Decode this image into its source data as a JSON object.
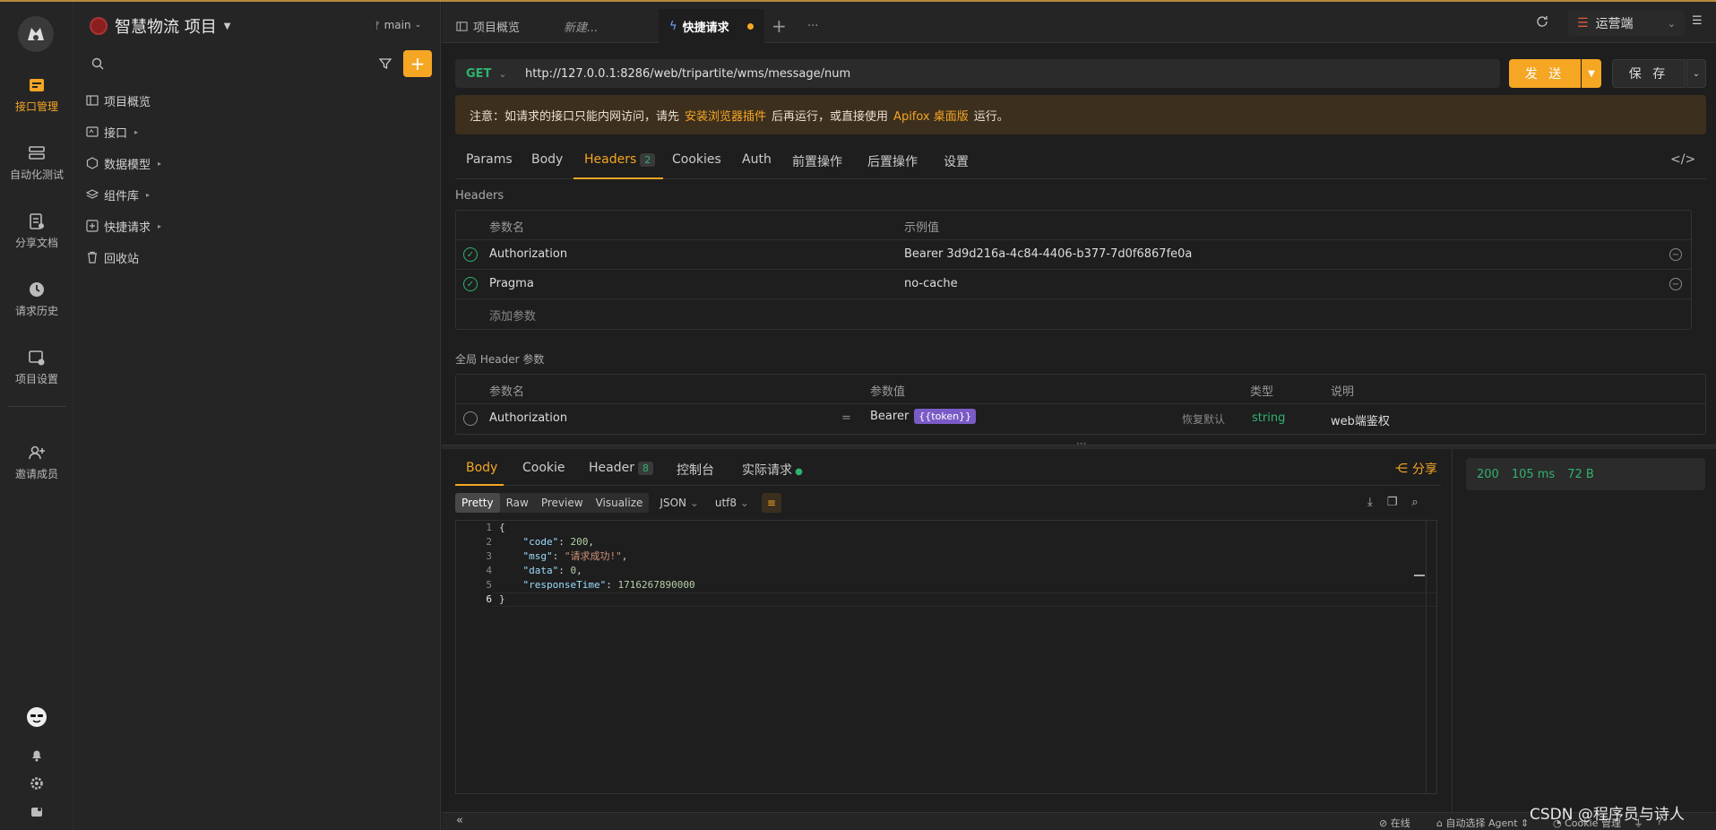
{
  "rail": {
    "items": [
      {
        "label": "接口管理",
        "icon": "api-icon",
        "active": true
      },
      {
        "label": "自动化测试",
        "icon": "automation-icon"
      },
      {
        "label": "分享文档",
        "icon": "doc-share-icon"
      },
      {
        "label": "请求历史",
        "icon": "history-icon"
      },
      {
        "label": "项目设置",
        "icon": "project-settings-icon"
      },
      {
        "label": "邀请成员",
        "icon": "invite-member-icon"
      }
    ]
  },
  "project": {
    "name": "智慧物流 项目",
    "branch": "main"
  },
  "tree": {
    "items": [
      {
        "label": "项目概览",
        "icon": "overview-icon",
        "caret": false
      },
      {
        "label": "接口",
        "icon": "api-folder-icon",
        "caret": true
      },
      {
        "label": "数据模型",
        "icon": "data-model-icon",
        "caret": true
      },
      {
        "label": "组件库",
        "icon": "components-icon",
        "caret": true
      },
      {
        "label": "快捷请求",
        "icon": "quick-request-icon",
        "caret": true
      },
      {
        "label": "回收站",
        "icon": "trash-icon",
        "caret": false
      }
    ]
  },
  "tabs": [
    {
      "label": "项目概览",
      "active": false
    },
    {
      "label": "新建...",
      "active": false
    },
    {
      "label": "快捷请求",
      "active": true
    }
  ],
  "env": {
    "label": "运营端"
  },
  "request": {
    "method": "GET",
    "url": "http://127.0.0.1:8286/web/tripartite/wms/message/num",
    "send_label": "发 送",
    "save_label": "保 存"
  },
  "notice": {
    "prefix": "注意：如请求的接口只能内网访问，请先",
    "link1": "安装浏览器插件",
    "middle": "后再运行，或直接使用",
    "link2": "Apifox 桌面版",
    "suffix": "运行。"
  },
  "req_tabs": {
    "params": "Params",
    "body": "Body",
    "headers": "Headers",
    "headers_count": "2",
    "cookies": "Cookies",
    "auth": "Auth",
    "pre": "前置操作",
    "post": "后置操作",
    "settings": "设置"
  },
  "headers": {
    "section": "Headers",
    "col_name": "参数名",
    "col_example": "示例值",
    "rows": [
      {
        "name": "Authorization",
        "value": "Bearer 3d9d216a-4c84-4406-b377-7d0f6867fe0a"
      },
      {
        "name": "Pragma",
        "value": "no-cache"
      }
    ],
    "add_placeholder": "添加参数"
  },
  "global_headers": {
    "section": "全局 Header 参数",
    "col_name": "参数名",
    "col_value": "参数值",
    "col_type": "类型",
    "col_desc": "说明",
    "row": {
      "name": "Authorization",
      "eq": "=",
      "value": "Bearer",
      "token": "{{token}}",
      "restore": "恢复默认",
      "type": "string",
      "desc": "web端鉴权"
    }
  },
  "response": {
    "tabs": {
      "body": "Body",
      "cookie": "Cookie",
      "header": "Header",
      "header_count": "8",
      "console": "控制台",
      "actual": "实际请求"
    },
    "share": "分享",
    "views": [
      "Pretty",
      "Raw",
      "Preview",
      "Visualize"
    ],
    "format": "JSON",
    "encoding": "utf8",
    "status": "200",
    "time": "105 ms",
    "size": "72 B",
    "line_numbers": [
      "1",
      "2",
      "3",
      "4",
      "5",
      "6"
    ]
  },
  "footer": {
    "online": "在线",
    "agent": "自动选择 Agent",
    "cookie": "Cookie 管理"
  },
  "watermark": "CSDN @程序员与诗人"
}
